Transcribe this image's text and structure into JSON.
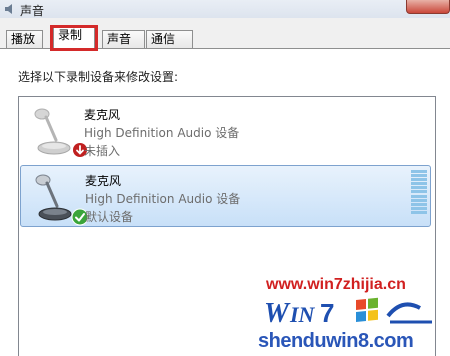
{
  "window": {
    "title": "声音"
  },
  "tabs": [
    {
      "label": "播放",
      "active": false
    },
    {
      "label": "录制",
      "active": true
    },
    {
      "label": "声音",
      "active": false
    },
    {
      "label": "通信",
      "active": false
    }
  ],
  "instruction": "选择以下录制设备来修改设置:",
  "devices": [
    {
      "name": "麦克风",
      "driver": "High Definition Audio 设备",
      "status": "未插入",
      "selected": false,
      "badge_icon": "unplugged-arrow-icon"
    },
    {
      "name": "麦克风",
      "driver": "High Definition Audio 设备",
      "status": "默认设备",
      "selected": true,
      "badge_icon": "default-check-icon"
    }
  ],
  "watermark": {
    "url": "www.win7zhijia.cn",
    "site": "shenduwin8.com"
  },
  "colors": {
    "highlight_box": "#d42a2a",
    "selection": "#c8e0f8",
    "default_badge": "#3aa53a",
    "unplugged_badge": "#c02020"
  }
}
